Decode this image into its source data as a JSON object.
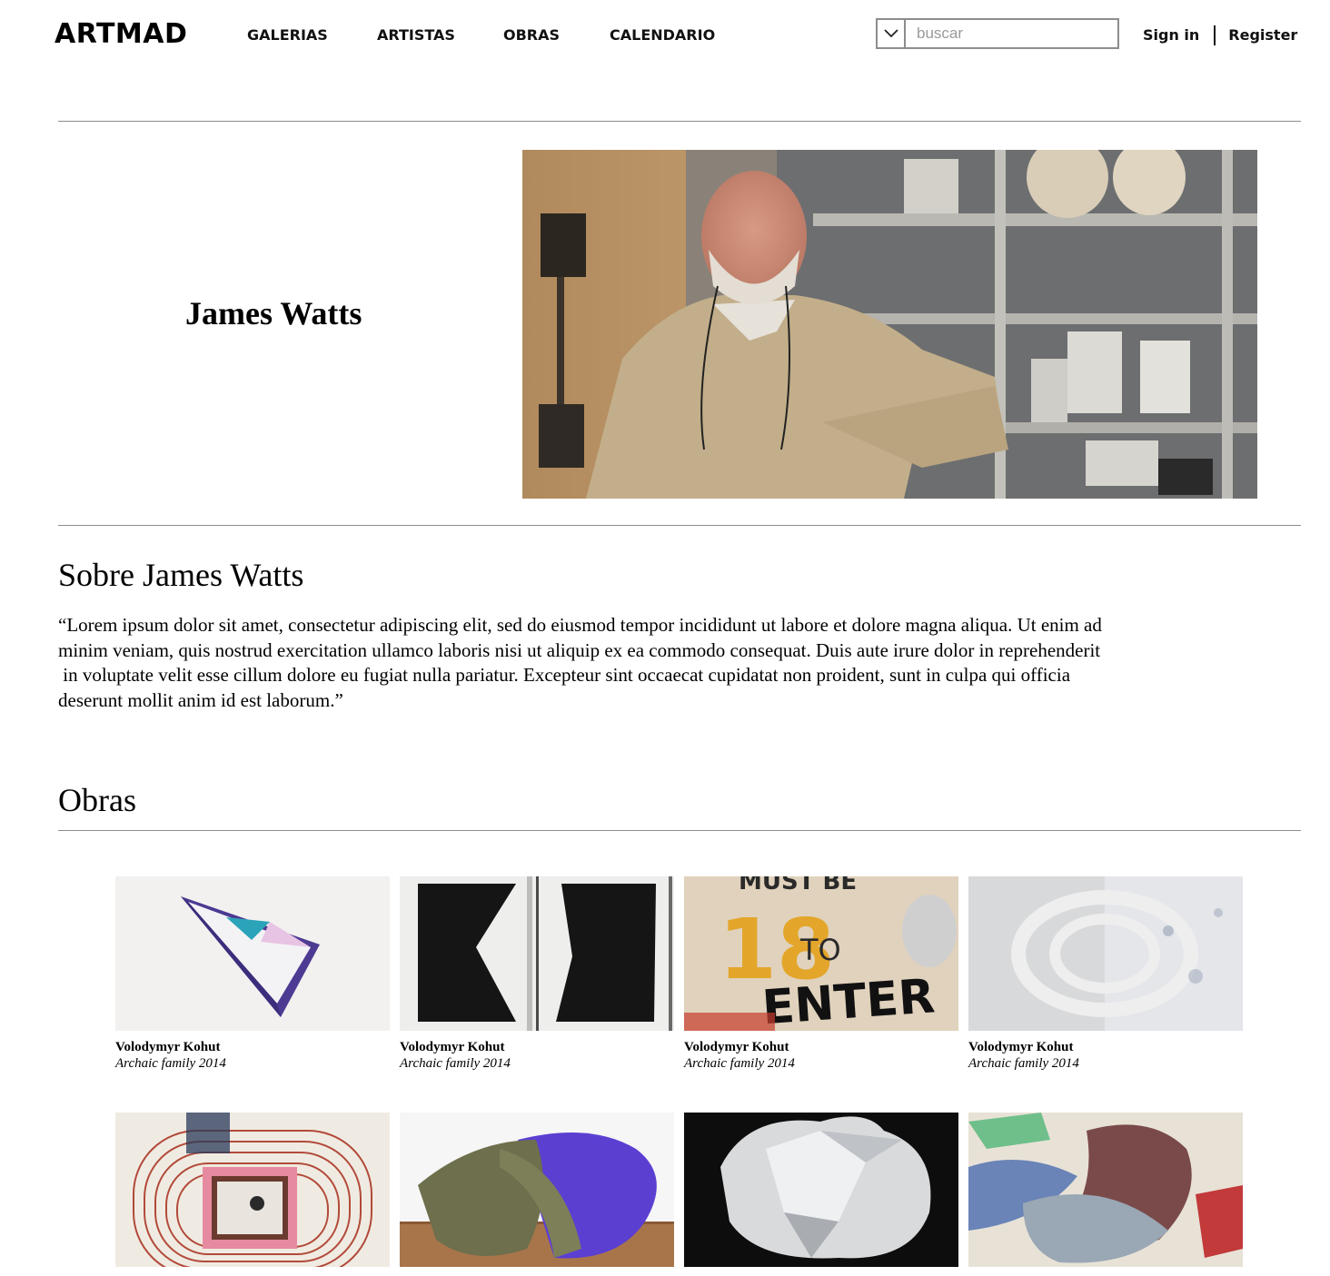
{
  "header": {
    "logo": "ARTMAD",
    "nav": [
      "GALERIAS",
      "ARTISTAS",
      "OBRAS",
      "CALENDARIO"
    ],
    "search_placeholder": "buscar",
    "sign_in": "Sign in",
    "register": "Register"
  },
  "artist": {
    "name": "James Watts"
  },
  "about": {
    "title": "Sobre James Watts",
    "lines": [
      "“Lorem ipsum dolor sit amet, consectetur adipiscing elit, sed do eiusmod tempor incididunt ut labore et dolore magna aliqua. Ut enim ad",
      "minim veniam, quis nostrud exercitation ullamco laboris nisi ut aliquip ex ea commodo consequat. Duis aute irure dolor in reprehenderit",
      " in voluptate velit esse cillum dolore eu fugiat nulla pariatur. Excepteur sint occaecat cupidatat non proident, sunt in culpa qui officia",
      "deserunt mollit anim id est laborum.”"
    ]
  },
  "works": {
    "title": "Obras",
    "items": [
      {
        "artist": "Volodymyr Kohut",
        "title": "Archaic family 2014"
      },
      {
        "artist": "Volodymyr Kohut",
        "title": "Archaic family 2014"
      },
      {
        "artist": "Volodymyr Kohut",
        "title": "Archaic family 2014",
        "image_text": [
          "MUST BE",
          "18",
          "TO",
          "ENTER"
        ]
      },
      {
        "artist": "Volodymyr Kohut",
        "title": "Archaic family 2014"
      },
      {},
      {},
      {},
      {}
    ]
  }
}
